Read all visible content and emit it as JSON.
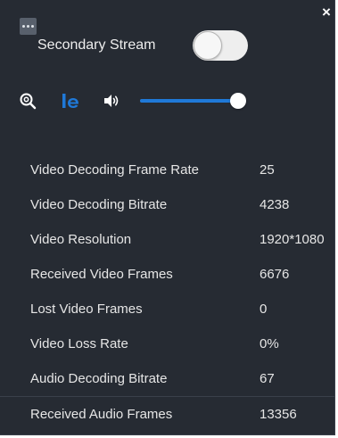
{
  "panel": {
    "menu_icon": "ellipsis-icon",
    "close_label": "×"
  },
  "secondary_stream": {
    "label": "Secondary Stream",
    "enabled": false
  },
  "controls": {
    "zoom_icon": "zoom-icon",
    "ie_icon": "ie-icon",
    "volume_icon": "volume-icon",
    "volume_level": 1.0,
    "accent_color": "#1f79d8"
  },
  "stats": [
    {
      "label": "Video Decoding Frame Rate",
      "value": "25"
    },
    {
      "label": "Video Decoding Bitrate",
      "value": "4238"
    },
    {
      "label": "Video Resolution",
      "value": "1920*1080"
    },
    {
      "label": "Received Video Frames",
      "value": "6676"
    },
    {
      "label": "Lost Video Frames",
      "value": "0"
    },
    {
      "label": "Video Loss Rate",
      "value": "0%"
    },
    {
      "label": "Audio Decoding Bitrate",
      "value": "67"
    },
    {
      "label": "Received Audio Frames",
      "value": "13356"
    }
  ]
}
